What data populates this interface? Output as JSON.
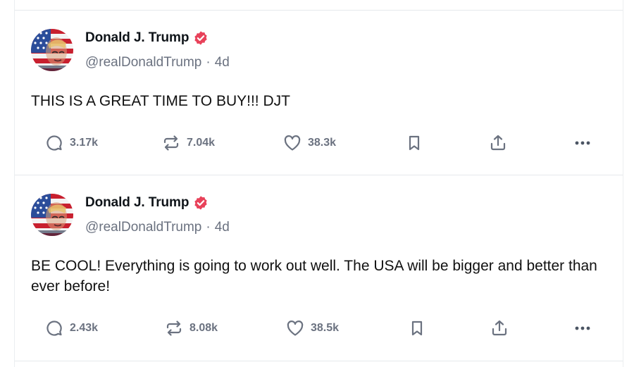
{
  "posts": [
    {
      "display_name": "Donald J. Trump",
      "handle": "@realDonaldTrump",
      "separator": "·",
      "time": "4d",
      "text": "THIS IS A GREAT TIME TO BUY!!! DJT",
      "stats": {
        "replies": "3.17k",
        "reposts": "7.04k",
        "likes": "38.3k"
      }
    },
    {
      "display_name": "Donald J. Trump",
      "handle": "@realDonaldTrump",
      "separator": "·",
      "time": "4d",
      "text": "BE COOL! Everything is going to work out well. The USA will be bigger and better than ever before!",
      "stats": {
        "replies": "2.43k",
        "reposts": "8.08k",
        "likes": "38.5k"
      }
    }
  ],
  "icons": {
    "reply": "speech-bubble-icon",
    "repost": "repost-arrows-icon",
    "like": "heart-icon",
    "bookmark": "bookmark-icon",
    "share": "share-upload-icon",
    "more": "more-dots-icon",
    "verified": "verified-badge-icon"
  },
  "colors": {
    "verified_badge": "#e8425a",
    "muted_text": "#6b7280",
    "divider": "#e6e9ec"
  }
}
